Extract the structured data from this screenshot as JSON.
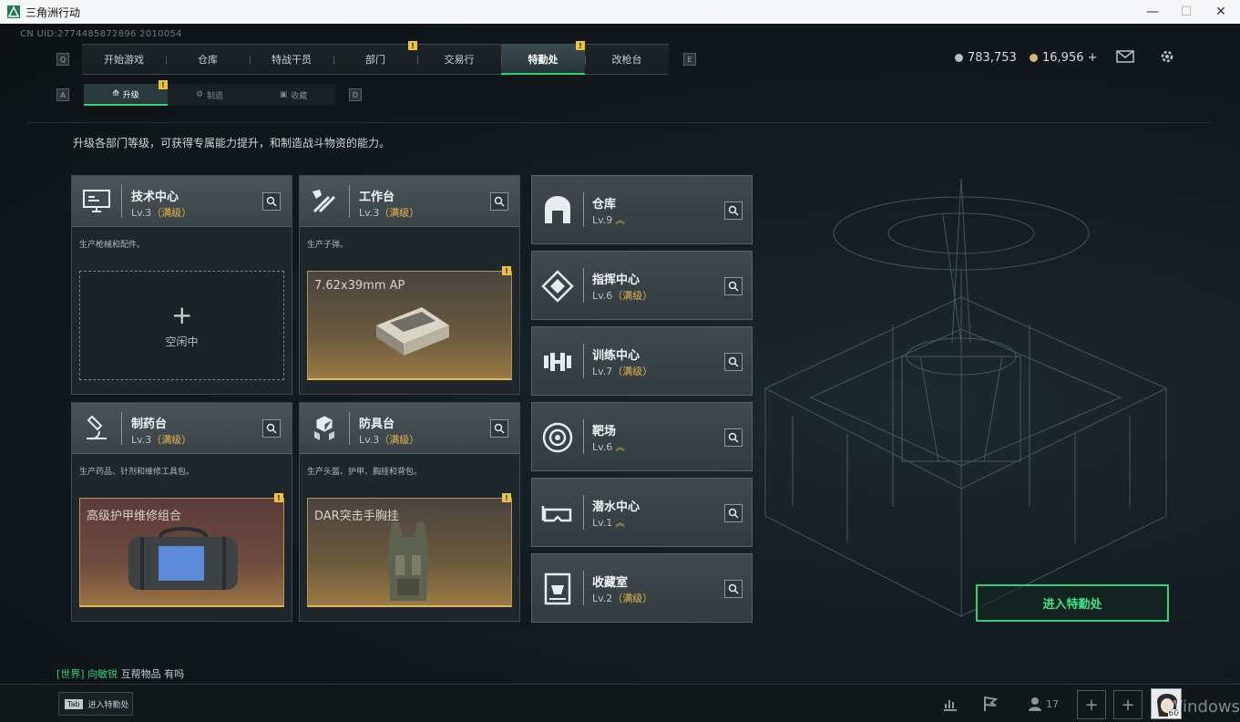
{
  "window": {
    "title": "三角洲行动",
    "controls": [
      "—",
      "☐",
      "✕"
    ]
  },
  "uid": "CN UID:2774485872896 2010054",
  "nav": {
    "left_key": "Q",
    "right_key": "E",
    "tabs": [
      {
        "label": "开始游戏",
        "badge": ""
      },
      {
        "label": "仓库",
        "badge": ""
      },
      {
        "label": "特战干员",
        "badge": ""
      },
      {
        "label": "部门",
        "badge": "!"
      },
      {
        "label": "交易行",
        "badge": ""
      },
      {
        "label": "特勤处",
        "badge": "!"
      },
      {
        "label": "改枪台",
        "badge": ""
      }
    ],
    "active_index": 5
  },
  "currency": {
    "silver": "783,753",
    "gold": "16,956 +"
  },
  "subnav": {
    "left_key": "A",
    "right_key": "D",
    "tabs": [
      {
        "label": "升级",
        "badge": "!"
      },
      {
        "label": "制造",
        "badge": ""
      },
      {
        "label": "收藏",
        "badge": ""
      }
    ]
  },
  "description": "升级各部门等级，可获得专属能力提升，和制造战斗物资的能力。",
  "cards": [
    {
      "name": "技术中心",
      "level": "Lv.3",
      "max": "（满级）",
      "sub": "生产枪械和配件。",
      "slot": {
        "type": "empty",
        "label": "空闲中"
      }
    },
    {
      "name": "工作台",
      "level": "Lv.3",
      "max": "（满级）",
      "sub": "生产子弹。",
      "slot": {
        "type": "gold",
        "label": "7.62x39mm AP",
        "badge": "!"
      }
    },
    {
      "name": "制药台",
      "level": "Lv.3",
      "max": "（满级）",
      "sub": "生产药品、针剂和维修工具包。",
      "slot": {
        "type": "red",
        "label": "高级护甲维修组合",
        "badge": "!"
      }
    },
    {
      "name": "防具台",
      "level": "Lv.3",
      "max": "（满级）",
      "sub": "生产头盔、护甲、胸挂和背包。",
      "slot": {
        "type": "gold",
        "label": "DAR突击手胸挂",
        "badge": "!"
      }
    }
  ],
  "facilities": [
    {
      "name": "仓库",
      "level": "Lv.9",
      "max": "",
      "up": "︽"
    },
    {
      "name": "指挥中心",
      "level": "Lv.6",
      "max": "（满级）",
      "up": ""
    },
    {
      "name": "训练中心",
      "level": "Lv.7",
      "max": "（满级）",
      "up": ""
    },
    {
      "name": "靶场",
      "level": "Lv.6",
      "max": "",
      "up": "︽"
    },
    {
      "name": "潜水中心",
      "level": "Lv.1",
      "max": "",
      "up": "︽"
    },
    {
      "name": "收藏室",
      "level": "Lv.2",
      "max": "（满级）",
      "up": ""
    }
  ],
  "enter_button": "进入特勤处",
  "chat": {
    "channel": "[世界]",
    "user": "向敏锐",
    "message": "互帮物品 有吗"
  },
  "bottom": {
    "tab_key": "Tab",
    "tab_label": "进入特勤处",
    "friends_count": "17",
    "watermark": "Windows",
    "level": "60"
  },
  "colors": {
    "accent_green": "#2fd17a",
    "badge_yellow": "#f0c23a",
    "max_gold": "#e8b54a"
  }
}
